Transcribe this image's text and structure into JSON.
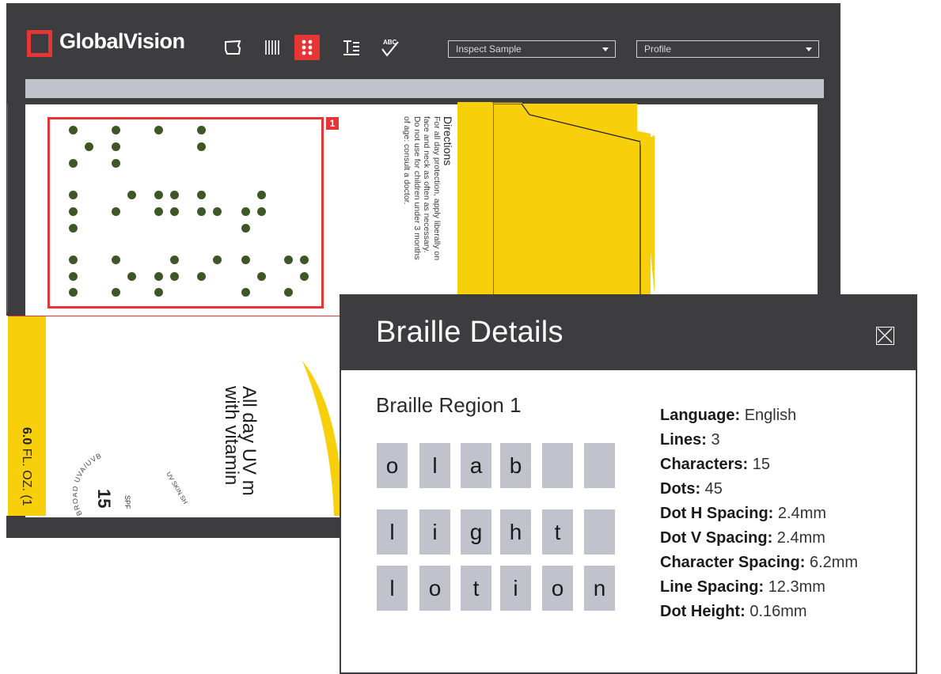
{
  "app": {
    "brand": "GlobalVision",
    "toolbar": {
      "icons": [
        "artwork-icon",
        "barcode-icon",
        "braille-icon",
        "text-icon",
        "spelling-icon"
      ],
      "spell_label": "ABC",
      "active_tool": "braille-icon",
      "accent_color": "#e63534"
    },
    "inspect_dropdown": {
      "value": "Inspect Sample"
    },
    "profile_dropdown": {
      "value": "Profile"
    }
  },
  "artwork": {
    "region_badge": "1",
    "directions": {
      "title": "Directions",
      "lines": [
        "For all day protection, apply liberally on",
        "face and neck as often as necessary.",
        "Do not use for children under 3 months",
        "of age: consult a doctor."
      ]
    },
    "fl_oz": {
      "bold": "6.0",
      "rest": " FL. OZ. (1"
    },
    "spf": {
      "label": "SPF",
      "number": "15",
      "seal_text": "BROAD UVA/UVB",
      "seal_text_right": "UV SKIN SH"
    },
    "uv_lines": [
      "All day UV m",
      "with vitamin"
    ],
    "yellow": "#f8cf0b",
    "dot_color": "#3e5726"
  },
  "braille_modal": {
    "title": "Braille Details",
    "region_title": "Braille Region 1",
    "grid": [
      [
        "o",
        "l",
        "a",
        "b",
        "",
        ""
      ],
      [
        "l",
        "i",
        "g",
        "h",
        "t",
        ""
      ],
      [
        "l",
        "o",
        "t",
        "i",
        "o",
        "n"
      ]
    ],
    "details": [
      {
        "label": "Language:",
        "value": "English"
      },
      {
        "label": "Lines:",
        "value": "3"
      },
      {
        "label": "Characters:",
        "value": "15"
      },
      {
        "label": "Dots:",
        "value": "45"
      },
      {
        "label": "Dot H Spacing:",
        "value": "2.4mm"
      },
      {
        "label": "Dot V Spacing:",
        "value": "2.4mm"
      },
      {
        "label": "Character Spacing:",
        "value": "6.2mm"
      },
      {
        "label": "Line Spacing:",
        "value": "12.3mm"
      },
      {
        "label": "Dot Height:",
        "value": "0.16mm"
      }
    ]
  }
}
